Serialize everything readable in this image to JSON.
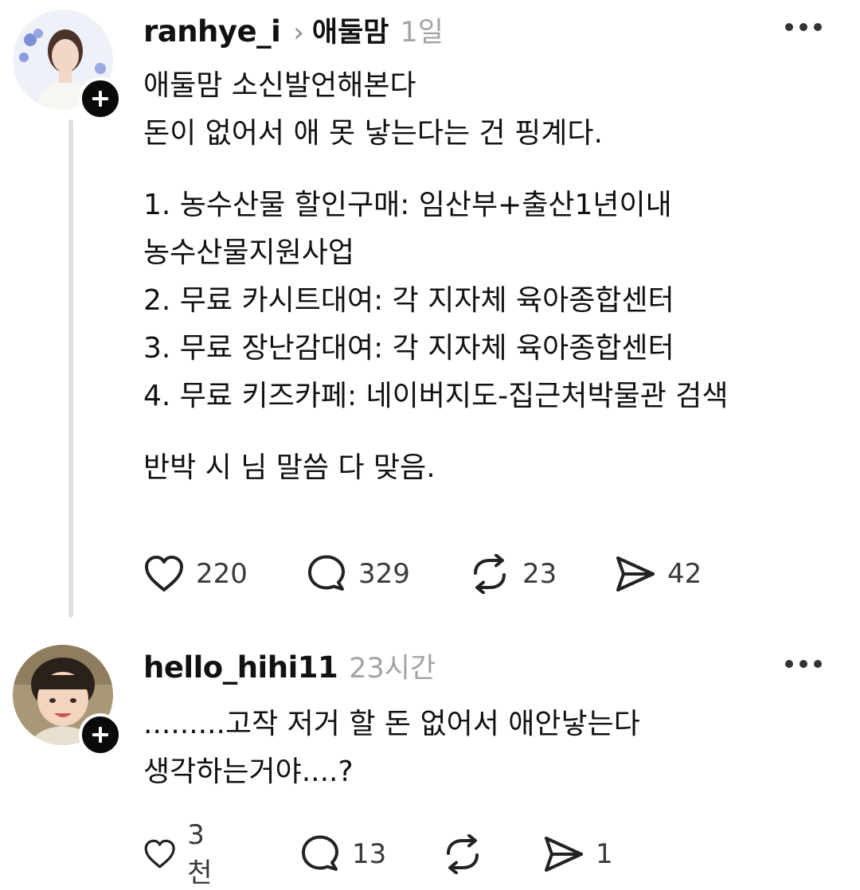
{
  "posts": [
    {
      "username": "ranhye_i",
      "community": "애둘맘",
      "time": "1일",
      "lines": [
        "애둘맘 소신발언해본다",
        "돈이 없어서 애 못 낳는다는 건 핑계다.",
        "",
        "1. 농수산물 할인구매: 임산부+출산1년이내",
        "농수산물지원사업",
        "2. 무료 카시트대여: 각 지자체 육아종합센터",
        "3. 무료 장난감대여: 각 지자체 육아종합센터",
        "4. 무료 키즈카페: 네이버지도-집근처박물관 검색",
        "",
        "반박 시 님 말씀 다 맞음."
      ],
      "likes": "220",
      "comments": "329",
      "reposts": "23",
      "shares": "42"
    },
    {
      "username": "hello_hihi11",
      "time": "23시간",
      "lines": [
        ".........고작 저거 할 돈 없어서 애안낳는다",
        "생각하는거야....?"
      ],
      "likes": "3천",
      "comments": "13",
      "reposts": "",
      "shares": "1"
    }
  ],
  "icons": {
    "follow": "plus-icon",
    "more": "more-horizontal-icon",
    "like": "heart-icon",
    "comment": "comment-bubble-icon",
    "repost": "repost-icon",
    "share": "send-icon"
  },
  "colors": {
    "text": "#111111",
    "muted": "#a3a3a3",
    "thread_line": "#e1e1e1",
    "follow_badge": "#0a0a0a"
  }
}
